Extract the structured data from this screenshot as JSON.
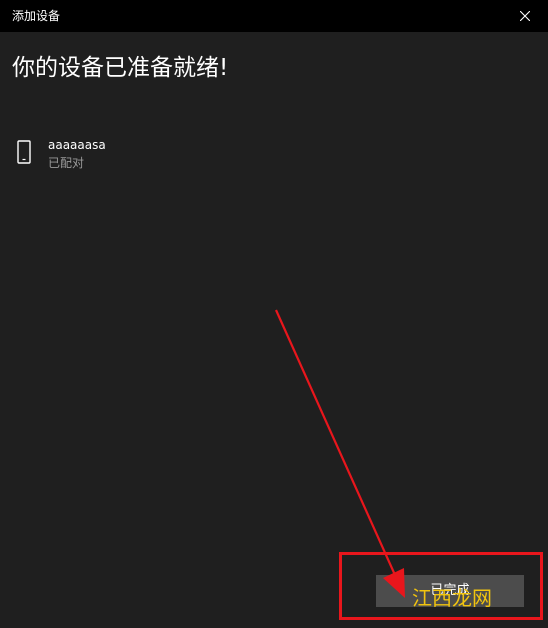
{
  "window": {
    "title": "添加设备",
    "close_icon": "close-icon"
  },
  "main": {
    "heading": "你的设备已准备就绪!"
  },
  "device": {
    "icon": "phone-icon",
    "name": "aaaaaasa",
    "status": "已配对"
  },
  "footer": {
    "done_label": "已完成"
  },
  "annotation": {
    "highlight_color": "#e8161c",
    "arrow_color": "#e8161c"
  },
  "watermark": {
    "text": "江西龙网"
  },
  "colors": {
    "background": "#1f1f1f",
    "titlebar": "#000000",
    "button": "#4c4c4c",
    "secondary_text": "#9a9a9a"
  }
}
